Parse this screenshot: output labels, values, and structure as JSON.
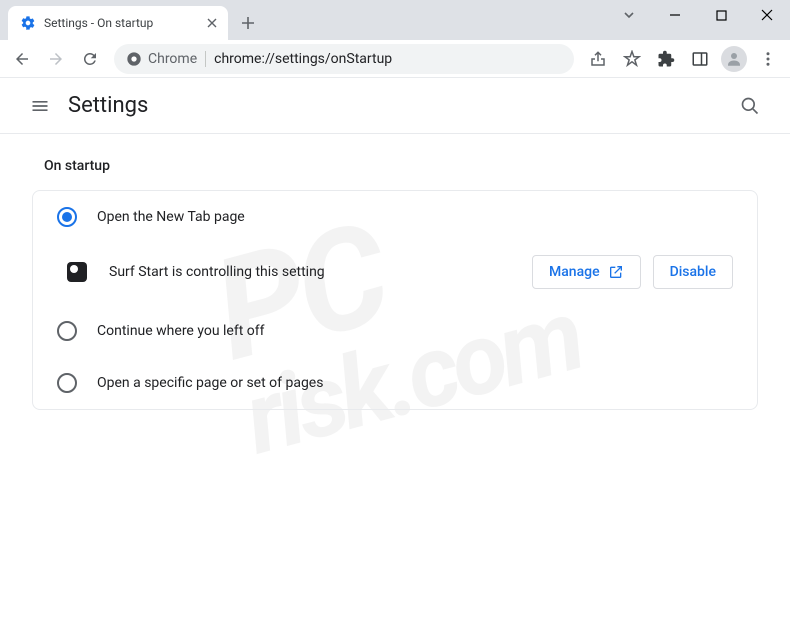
{
  "window": {
    "tab_title": "Settings - On startup"
  },
  "toolbar": {
    "chrome_label": "Chrome",
    "url": "chrome://settings/onStartup"
  },
  "header": {
    "title": "Settings"
  },
  "section": {
    "title": "On startup",
    "options": [
      {
        "label": "Open the New Tab page",
        "selected": true
      },
      {
        "label": "Continue where you left off",
        "selected": false
      },
      {
        "label": "Open a specific page or set of pages",
        "selected": false
      }
    ],
    "extension_notice": "Surf Start is controlling this setting",
    "manage_label": "Manage",
    "disable_label": "Disable"
  },
  "watermark": {
    "line1": "PC",
    "line2": "risk.com"
  }
}
